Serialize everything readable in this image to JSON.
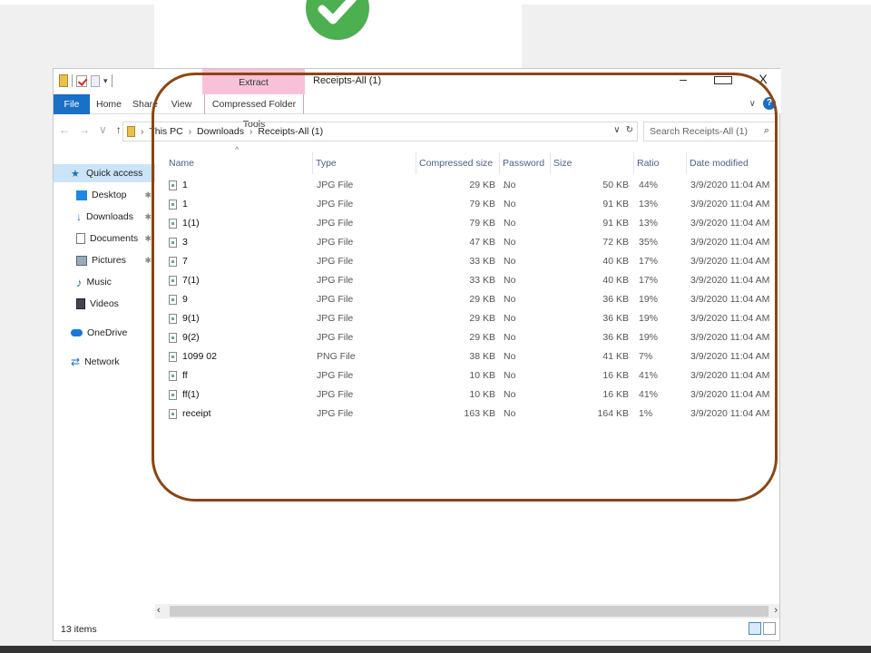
{
  "window": {
    "title": "Receipts-All (1)",
    "extract_tab": "Extract",
    "controls": {
      "minimize": "–",
      "close": "X"
    }
  },
  "ribbon": {
    "tabs": [
      "File",
      "Home",
      "Share",
      "View",
      "Compressed Folder Tools"
    ],
    "help": "?"
  },
  "address": {
    "crumbs": [
      "This PC",
      "Downloads",
      "Receipts-All (1)"
    ],
    "search_placeholder": "Search Receipts-All (1)"
  },
  "nav": {
    "items": [
      {
        "label": "Quick access",
        "icon": "star-icon"
      },
      {
        "label": "Desktop",
        "icon": "desktop-icon"
      },
      {
        "label": "Downloads",
        "icon": "download-icon"
      },
      {
        "label": "Documents",
        "icon": "document-icon"
      },
      {
        "label": "Pictures",
        "icon": "pictures-icon"
      },
      {
        "label": "Music",
        "icon": "music-icon"
      },
      {
        "label": "Videos",
        "icon": "videos-icon"
      },
      {
        "label": "OneDrive",
        "icon": "cloud-icon"
      },
      {
        "label": "Network",
        "icon": "network-icon"
      }
    ]
  },
  "columns": [
    "Name",
    "Type",
    "Compressed size",
    "Password ...",
    "Size",
    "Ratio",
    "Date modified"
  ],
  "files": [
    {
      "name": "1",
      "type": "JPG File",
      "compressed": "29 KB",
      "password": "No",
      "size": "50 KB",
      "ratio": "44%",
      "date": "3/9/2020 11:04 AM"
    },
    {
      "name": "1",
      "type": "JPG File",
      "compressed": "79 KB",
      "password": "No",
      "size": "91 KB",
      "ratio": "13%",
      "date": "3/9/2020 11:04 AM"
    },
    {
      "name": "1(1)",
      "type": "JPG File",
      "compressed": "79 KB",
      "password": "No",
      "size": "91 KB",
      "ratio": "13%",
      "date": "3/9/2020 11:04 AM"
    },
    {
      "name": "3",
      "type": "JPG File",
      "compressed": "47 KB",
      "password": "No",
      "size": "72 KB",
      "ratio": "35%",
      "date": "3/9/2020 11:04 AM"
    },
    {
      "name": "7",
      "type": "JPG File",
      "compressed": "33 KB",
      "password": "No",
      "size": "40 KB",
      "ratio": "17%",
      "date": "3/9/2020 11:04 AM"
    },
    {
      "name": "7(1)",
      "type": "JPG File",
      "compressed": "33 KB",
      "password": "No",
      "size": "40 KB",
      "ratio": "17%",
      "date": "3/9/2020 11:04 AM"
    },
    {
      "name": "9",
      "type": "JPG File",
      "compressed": "29 KB",
      "password": "No",
      "size": "36 KB",
      "ratio": "19%",
      "date": "3/9/2020 11:04 AM"
    },
    {
      "name": "9(1)",
      "type": "JPG File",
      "compressed": "29 KB",
      "password": "No",
      "size": "36 KB",
      "ratio": "19%",
      "date": "3/9/2020 11:04 AM"
    },
    {
      "name": "9(2)",
      "type": "JPG File",
      "compressed": "29 KB",
      "password": "No",
      "size": "36 KB",
      "ratio": "19%",
      "date": "3/9/2020 11:04 AM"
    },
    {
      "name": "1099 02",
      "type": "PNG File",
      "compressed": "38 KB",
      "password": "No",
      "size": "41 KB",
      "ratio": "7%",
      "date": "3/9/2020 11:04 AM"
    },
    {
      "name": "ff",
      "type": "JPG File",
      "compressed": "10 KB",
      "password": "No",
      "size": "16 KB",
      "ratio": "41%",
      "date": "3/9/2020 11:04 AM"
    },
    {
      "name": "ff(1)",
      "type": "JPG File",
      "compressed": "10 KB",
      "password": "No",
      "size": "16 KB",
      "ratio": "41%",
      "date": "3/9/2020 11:04 AM"
    },
    {
      "name": "receipt",
      "type": "JPG File",
      "compressed": "163 KB",
      "password": "No",
      "size": "164 KB",
      "ratio": "1%",
      "date": "3/9/2020 11:04 AM"
    }
  ],
  "status": {
    "items_count": "13 items"
  },
  "colors": {
    "accent": "#1a6fc6",
    "extract_tab": "#f9c1d9",
    "highlight": "#8b4513",
    "checkmark": "#4caf50"
  }
}
